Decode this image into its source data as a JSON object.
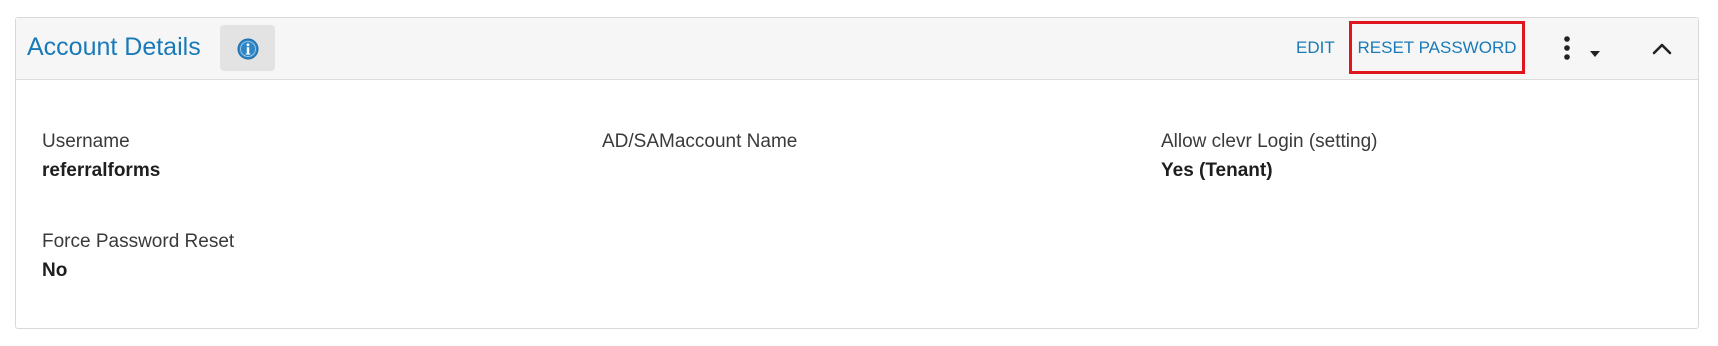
{
  "panel": {
    "title": "Account Details",
    "info_icon": "info-icon",
    "actions": {
      "edit_label": "EDIT",
      "reset_password_label": "RESET PASSWORD"
    },
    "more_icon": "kebab-menu-icon",
    "dropdown_icon": "caret-down-icon",
    "collapse_icon": "chevron-up-icon"
  },
  "fields": {
    "username": {
      "label": "Username",
      "value": "referralforms"
    },
    "ad_samaccount": {
      "label": "AD/SAMaccount Name",
      "value": ""
    },
    "allow_login": {
      "label": "Allow clevr Login (setting)",
      "value": "Yes (Tenant)"
    },
    "force_reset": {
      "label": "Force Password Reset",
      "value": "No"
    }
  },
  "colors": {
    "accent": "#1a7ab8",
    "highlight_border": "#e0161f",
    "header_bg": "#f6f6f6"
  }
}
